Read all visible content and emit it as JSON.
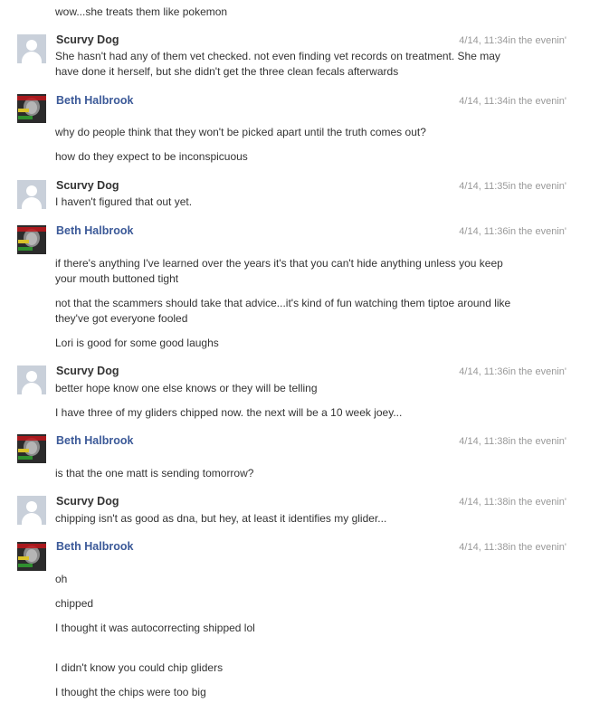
{
  "conversation": {
    "top_line": "wow...she treats them like pokemon",
    "groups": [
      {
        "sender": "Scurvy Dog",
        "avatar": "default-avatar",
        "timestamp": "4/14, 11:34in the evenin'",
        "messages": [
          "She hasn't had any of them vet checked. not even finding vet records on treatment. She may have done it herself, but she didn't get the three clean fecals afterwards"
        ]
      },
      {
        "sender": "Beth Halbrook",
        "avatar": "beth-avatar",
        "timestamp": "4/14, 11:34in the evenin'",
        "messages": [
          "why do people think that they won't be picked apart until the truth comes out?",
          "how do they expect to be inconspicuous"
        ]
      },
      {
        "sender": "Scurvy Dog",
        "avatar": "default-avatar",
        "timestamp": "4/14, 11:35in the evenin'",
        "messages": [
          "I haven't figured that out yet."
        ]
      },
      {
        "sender": "Beth Halbrook",
        "avatar": "beth-avatar",
        "timestamp": "4/14, 11:36in the evenin'",
        "messages": [
          "if there's anything I've learned over the years it's that you can't hide anything unless you keep your mouth buttoned tight",
          "not that the scammers should take that advice...it's kind of fun watching them tiptoe around like they've got everyone fooled",
          "Lori is good for some good laughs"
        ]
      },
      {
        "sender": "Scurvy Dog",
        "avatar": "default-avatar",
        "timestamp": "4/14, 11:36in the evenin'",
        "messages": [
          "better hope know one else knows or they will be telling",
          "I have three of my gliders chipped now. the next will be a 10 week joey..."
        ]
      },
      {
        "sender": "Beth Halbrook",
        "avatar": "beth-avatar",
        "timestamp": "4/14, 11:38in the evenin'",
        "messages": [
          "is that the one matt is sending tomorrow?"
        ]
      },
      {
        "sender": "Scurvy Dog",
        "avatar": "default-avatar",
        "timestamp": "4/14, 11:38in the evenin'",
        "messages": [
          "chipping isn't as good as dna, but hey, at least it identifies my glider..."
        ]
      },
      {
        "sender": "Beth Halbrook",
        "avatar": "beth-avatar",
        "timestamp": "4/14, 11:38in the evenin'",
        "messages": [
          "oh",
          "chipped",
          "I thought it was autocorrecting shipped lol",
          "I didn't know you could chip gliders",
          "I thought the chips were too big"
        ]
      }
    ]
  },
  "colors": {
    "link_name": "#3b5998",
    "timestamp": "#999999",
    "text": "#333333"
  }
}
